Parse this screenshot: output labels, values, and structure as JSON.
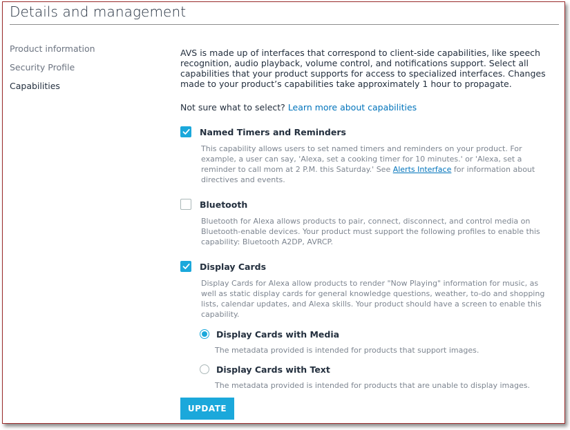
{
  "page": {
    "title": "Details and management"
  },
  "nav": {
    "items": [
      {
        "label": "Product information",
        "active": false
      },
      {
        "label": "Security Profile",
        "active": false
      },
      {
        "label": "Capabilities",
        "active": true
      }
    ]
  },
  "intro": "AVS is made up of interfaces that correspond to client-side capabilities, like speech recognition, audio playback, volume control, and notifications support. Select all capabilities that your product supports for access to specialized interfaces. Changes made to your product’s capabilities take approximately 1 hour to propagate.",
  "help": {
    "prompt": "Not sure what to select?",
    "link": "Learn more about capabilities"
  },
  "capabilities": [
    {
      "title": "Named Timers and Reminders",
      "checked": true,
      "desc_before": "This capability allows users to set named timers and reminders on your product. For example, a user can say, 'Alexa, set a cooking timer for 10 minutes.' or 'Alexa, set a reminder to call mom at 2 P.M. this Saturday.' See ",
      "desc_link": "Alerts Interface",
      "desc_after": " for information about directives and events."
    },
    {
      "title": "Bluetooth",
      "checked": false,
      "desc": "Bluetooth for Alexa allows products to pair, connect, disconnect, and control media on Bluetooth-enable devices. Your product must support the following profiles to enable this capability: Bluetooth A2DP, AVRCP."
    },
    {
      "title": "Display Cards",
      "checked": true,
      "desc": "Display Cards for Alexa allow products to render \"Now Playing\" information for music, as well as static display cards for general knowledge questions, weather, to-do and shopping lists, calendar updates, and Alexa skills. Your product should have a screen to enable this capability.",
      "options": [
        {
          "title": "Display Cards with Media",
          "selected": true,
          "desc": "The metadata provided is intended for products that support images."
        },
        {
          "title": "Display Cards with Text",
          "selected": false,
          "desc": "The metadata provided is intended for products that are unable to display images."
        }
      ]
    }
  ],
  "actions": {
    "update": "UPDATE"
  },
  "colors": {
    "accent": "#1ba8db",
    "link": "#0073bb",
    "text": "#232f3e",
    "muted": "#7d8590",
    "frame_border": "#9a2a2a"
  },
  "icons": {
    "check": "checkmark-icon"
  }
}
